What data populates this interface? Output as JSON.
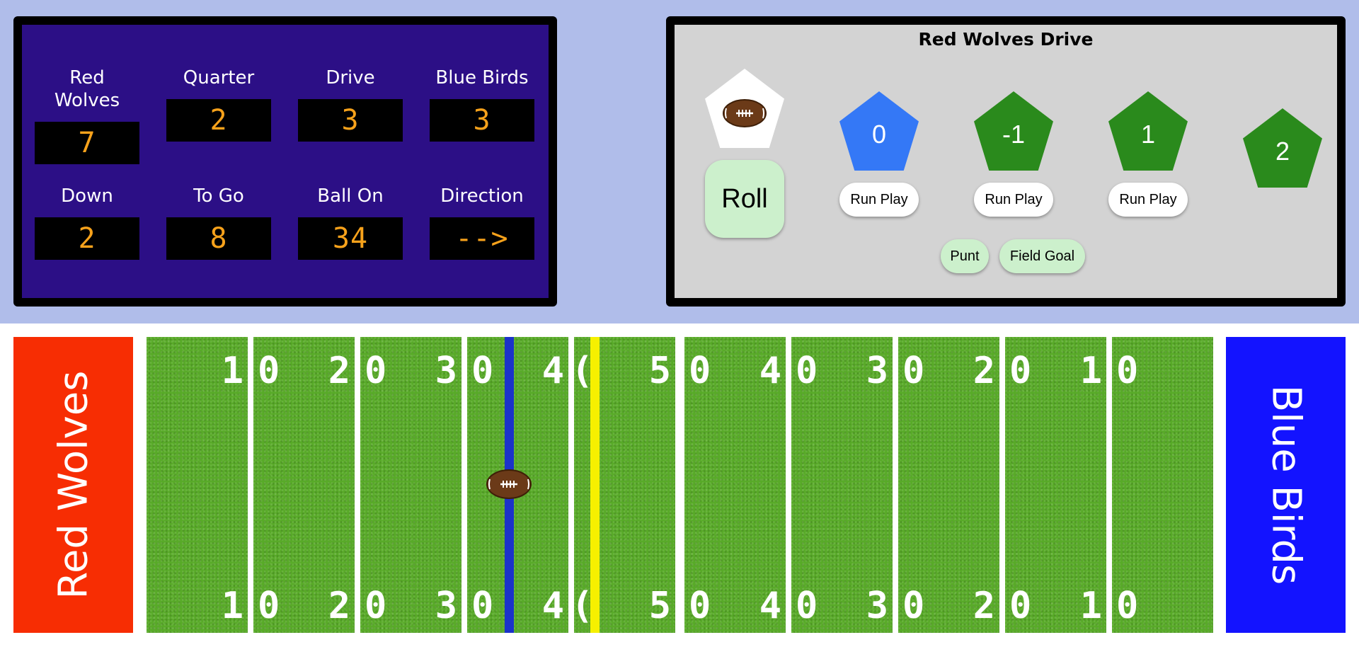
{
  "scoreboard": {
    "cells": [
      {
        "label": "Red Wolves",
        "value": "7"
      },
      {
        "label": "Quarter",
        "value": "2"
      },
      {
        "label": "Drive",
        "value": "3"
      },
      {
        "label": "Blue Birds",
        "value": "3"
      },
      {
        "label": "Down",
        "value": "2"
      },
      {
        "label": "To Go",
        "value": "8"
      },
      {
        "label": "Ball On",
        "value": "34"
      },
      {
        "label": "Direction",
        "value": "-->"
      }
    ],
    "colors": {
      "panel": "#2c0f86",
      "digits": "#f7a21b"
    }
  },
  "drive": {
    "title": "Red Wolves Drive",
    "die_icon": "football-icon",
    "roll_label": "Roll",
    "options": [
      {
        "value": "0",
        "color": "#3478f6",
        "action": "Run Play",
        "selected": true
      },
      {
        "value": "-1",
        "color": "#2a8a1c",
        "action": "Run Play"
      },
      {
        "value": "1",
        "color": "#2a8a1c",
        "action": "Run Play"
      },
      {
        "value": "2",
        "color": "#2a8a1c"
      }
    ],
    "punt_label": "Punt",
    "field_goal_label": "Field Goal"
  },
  "field": {
    "left_endzone": {
      "team": "Red Wolves",
      "color": "#f72d03"
    },
    "right_endzone": {
      "team": "Blue Birds",
      "color": "#1313ff"
    },
    "segments": [
      {
        "left": "1",
        "right": "0"
      },
      {
        "left": "2",
        "right": "0"
      },
      {
        "left": "3",
        "right": "0"
      },
      {
        "left": "4",
        "right": "("
      },
      {
        "left": "5",
        "right": "0"
      },
      {
        "left": "4",
        "right": "0"
      },
      {
        "left": "3",
        "right": "0"
      },
      {
        "left": "2",
        "right": "0"
      },
      {
        "left": "1",
        "right": "0"
      }
    ],
    "line_of_scrimmage_color": "#1b33c9",
    "first_down_line_color": "#f6f000",
    "ball_icon": "football-icon"
  }
}
